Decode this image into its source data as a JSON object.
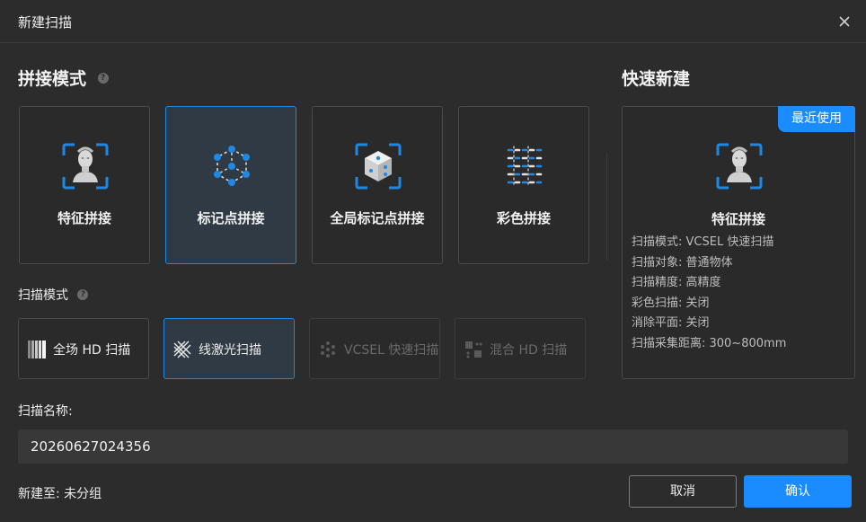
{
  "dialog": {
    "title": "新建扫描"
  },
  "stitch": {
    "heading": "拼接模式",
    "options": [
      {
        "label": "特征拼接",
        "icon": "bust-feature-icon"
      },
      {
        "label": "标记点拼接",
        "icon": "marker-points-icon",
        "selected": true
      },
      {
        "label": "全局标记点拼接",
        "icon": "global-marker-cube-icon"
      },
      {
        "label": "彩色拼接",
        "icon": "color-grid-icon"
      }
    ]
  },
  "scan_mode": {
    "heading": "扫描模式",
    "options": [
      {
        "label": "全场 HD 扫描",
        "icon": "stripes-icon"
      },
      {
        "label": "线激光扫描",
        "icon": "laser-lines-icon",
        "selected": true
      },
      {
        "label": "VCSEL 快速扫描",
        "icon": "vcsel-dots-icon",
        "disabled": true
      },
      {
        "label": "混合 HD 扫描",
        "icon": "hybrid-icon",
        "disabled": true
      }
    ]
  },
  "scan_name": {
    "label": "扫描名称:",
    "value": "20260627024356"
  },
  "group": {
    "text": "新建至: 未分组"
  },
  "quick": {
    "heading": "快速新建",
    "badge": "最近使用",
    "name": "特征拼接",
    "details": [
      "扫描模式: VCSEL 快速扫描",
      "扫描对象: 普通物体",
      "扫描精度: 高精度",
      "彩色扫描: 关闭",
      "消除平面: 关闭",
      "扫描采集距离: 300~800mm"
    ]
  },
  "buttons": {
    "cancel": "取消",
    "ok": "确认"
  },
  "colors": {
    "accent": "#1a8cff",
    "background": "#2c2c2c",
    "card_selected": "#2f3a44"
  }
}
